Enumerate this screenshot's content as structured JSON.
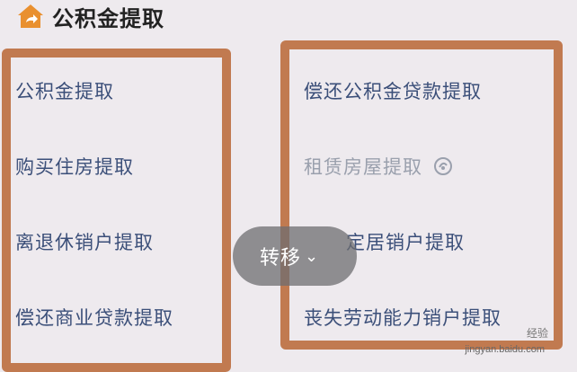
{
  "header": {
    "title": "公积金提取",
    "icon": "home-icon"
  },
  "left_column": [
    {
      "label": "公积金提取"
    },
    {
      "label": "购买住房提取"
    },
    {
      "label": "离退休销户提取"
    },
    {
      "label": "偿还商业贷款提取"
    }
  ],
  "right_column": [
    {
      "label": "偿还公积金贷款提取"
    },
    {
      "label": "租赁房屋提取"
    },
    {
      "label": "定居销户提取"
    },
    {
      "label": "丧失劳动能力销户提取"
    }
  ],
  "more_button": {
    "label": "转移"
  },
  "watermark": {
    "cn": "经验",
    "en": "jingyan.baidu.com"
  },
  "colors": {
    "highlight_border": "#c17a50",
    "link_text": "#3b4f79",
    "disabled_text": "#9aa0ad",
    "home_icon": "#e9902f"
  }
}
